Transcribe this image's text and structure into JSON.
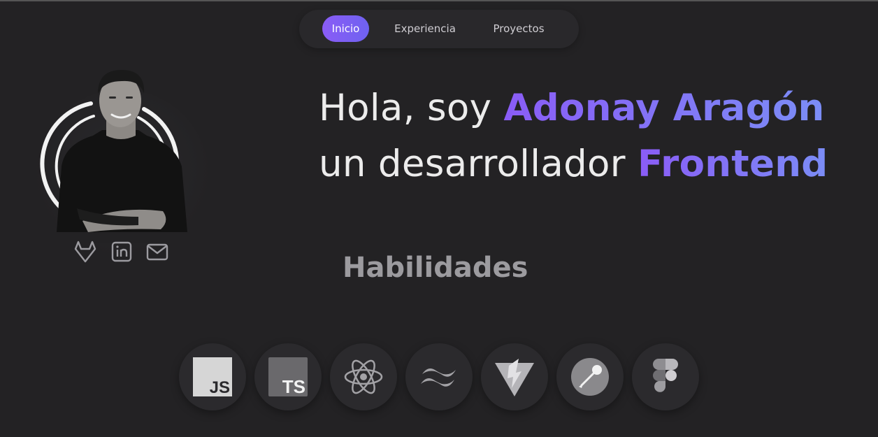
{
  "nav": {
    "items": [
      {
        "label": "Inicio",
        "active": true
      },
      {
        "label": "Experiencia",
        "active": false
      },
      {
        "label": "Proyectos",
        "active": false
      }
    ],
    "accent": "#8a5cf6"
  },
  "hero": {
    "line1_prefix": "Hola, soy ",
    "name": "Adonay Aragón",
    "line2_prefix": "un desarrollador ",
    "role": "Frontend"
  },
  "socials": [
    "gitlab-icon",
    "linkedin-icon",
    "mail-icon"
  ],
  "skills": {
    "title": "Habilidades",
    "items": [
      {
        "icon": "javascript-icon",
        "label": "JS"
      },
      {
        "icon": "typescript-icon",
        "label": "TS"
      },
      {
        "icon": "react-icon"
      },
      {
        "icon": "tailwind-icon"
      },
      {
        "icon": "vite-icon"
      },
      {
        "icon": "postman-icon"
      },
      {
        "icon": "figma-icon"
      }
    ]
  }
}
